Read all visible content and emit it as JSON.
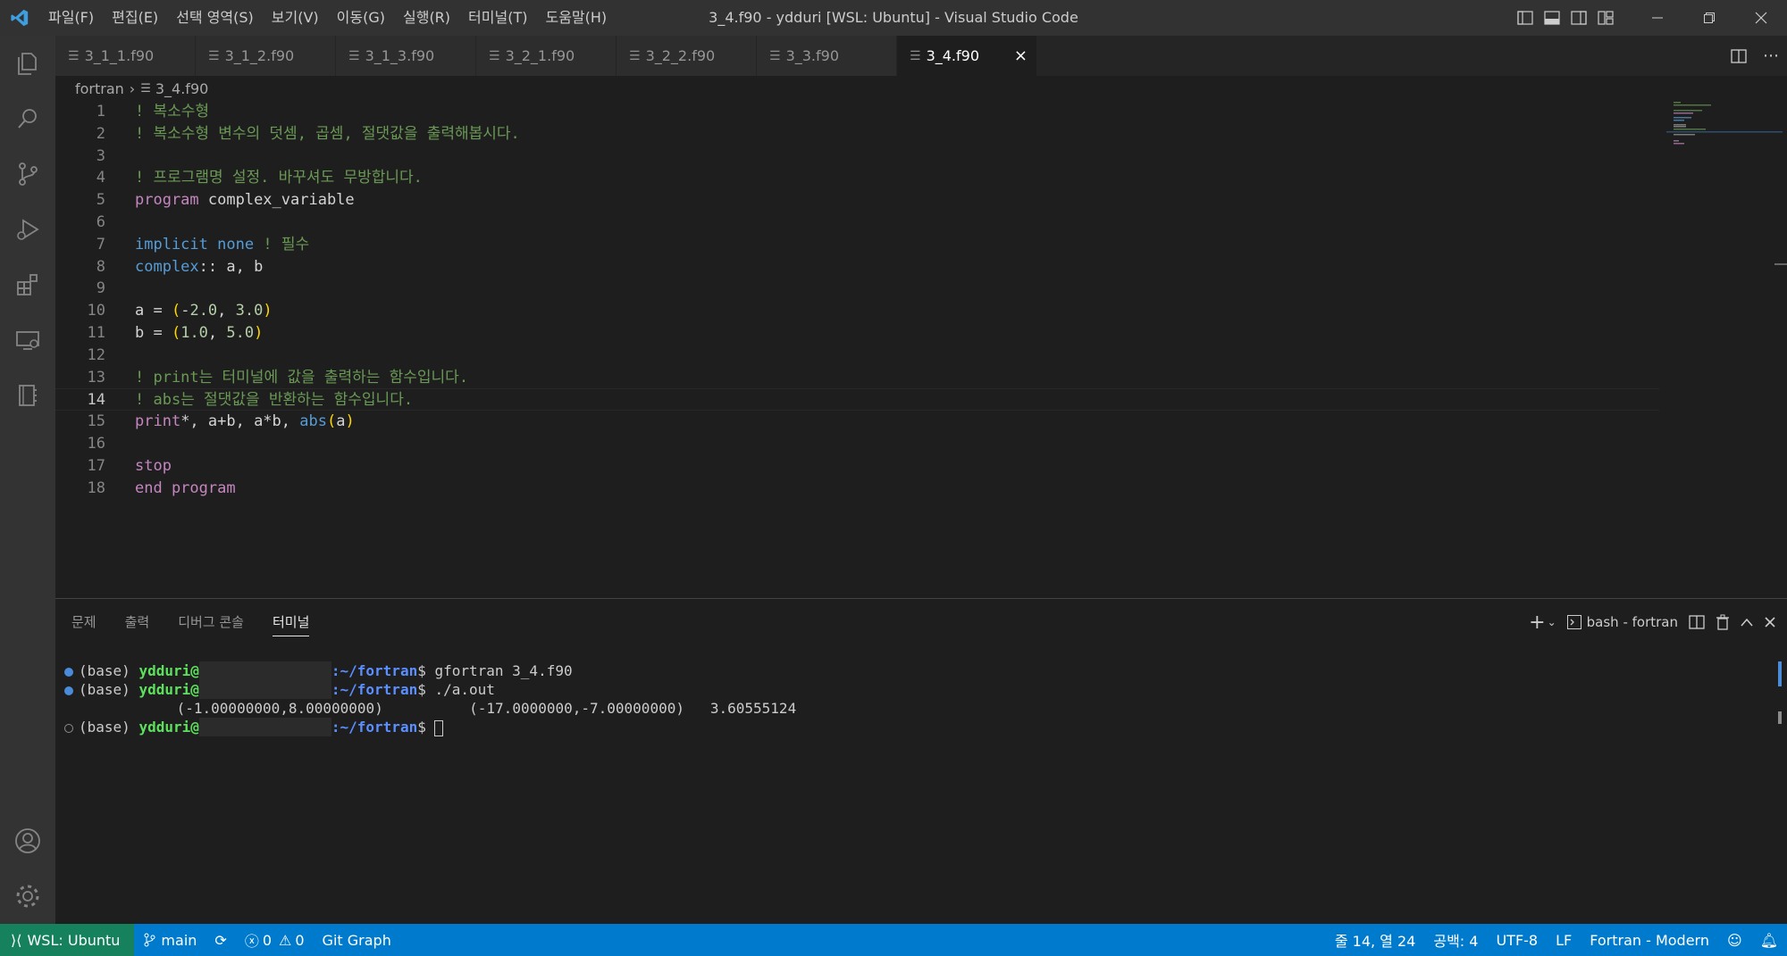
{
  "window": {
    "title": "3_4.f90 - ydduri [WSL: Ubuntu] - Visual Studio Code",
    "menu": [
      "파일(F)",
      "편집(E)",
      "선택 영역(S)",
      "보기(V)",
      "이동(G)",
      "실행(R)",
      "터미널(T)",
      "도움말(H)"
    ]
  },
  "tabs": [
    {
      "label": "3_1_1.f90",
      "active": false
    },
    {
      "label": "3_1_2.f90",
      "active": false
    },
    {
      "label": "3_1_3.f90",
      "active": false
    },
    {
      "label": "3_2_1.f90",
      "active": false
    },
    {
      "label": "3_2_2.f90",
      "active": false
    },
    {
      "label": "3_3.f90",
      "active": false
    },
    {
      "label": "3_4.f90",
      "active": true
    }
  ],
  "breadcrumb": {
    "folder": "fortran",
    "file": "3_4.f90"
  },
  "editor": {
    "current_line": 14,
    "lines": [
      {
        "n": "1",
        "tokens": [
          [
            "c-comment",
            "! 복소수형"
          ]
        ]
      },
      {
        "n": "2",
        "tokens": [
          [
            "c-comment",
            "! 복소수형 변수의 덧셈, 곱셈, 절댓값을 출력해봅시다."
          ]
        ]
      },
      {
        "n": "3",
        "tokens": []
      },
      {
        "n": "4",
        "tokens": [
          [
            "c-comment",
            "! 프로그램명 설정. 바꾸셔도 무방합니다."
          ]
        ]
      },
      {
        "n": "5",
        "tokens": [
          [
            "c-kw",
            "program"
          ],
          [
            "c-plain",
            " complex_variable"
          ]
        ]
      },
      {
        "n": "6",
        "tokens": []
      },
      {
        "n": "7",
        "tokens": [
          [
            "c-type",
            "implicit"
          ],
          [
            "c-plain",
            " "
          ],
          [
            "c-type",
            "none"
          ],
          [
            "c-plain",
            " "
          ],
          [
            "c-comment",
            "! 필수"
          ]
        ]
      },
      {
        "n": "8",
        "tokens": [
          [
            "c-type",
            "complex"
          ],
          [
            "c-plain",
            ":: a, b"
          ]
        ]
      },
      {
        "n": "9",
        "tokens": []
      },
      {
        "n": "10",
        "tokens": [
          [
            "c-plain",
            "a = "
          ],
          [
            "c-paren",
            "("
          ],
          [
            "c-plain",
            "-"
          ],
          [
            "c-num",
            "2.0"
          ],
          [
            "c-plain",
            ", "
          ],
          [
            "c-num",
            "3.0"
          ],
          [
            "c-paren",
            ")"
          ]
        ]
      },
      {
        "n": "11",
        "tokens": [
          [
            "c-plain",
            "b = "
          ],
          [
            "c-paren",
            "("
          ],
          [
            "c-num",
            "1.0"
          ],
          [
            "c-plain",
            ", "
          ],
          [
            "c-num",
            "5.0"
          ],
          [
            "c-paren",
            ")"
          ]
        ]
      },
      {
        "n": "12",
        "tokens": []
      },
      {
        "n": "13",
        "tokens": [
          [
            "c-comment",
            "! print는 터미널에 값을 출력하는 함수입니다."
          ]
        ]
      },
      {
        "n": "14",
        "tokens": [
          [
            "c-comment",
            "! abs는 절댓값을 반환하는 함수입니다."
          ]
        ]
      },
      {
        "n": "15",
        "tokens": [
          [
            "c-kw",
            "print"
          ],
          [
            "c-plain",
            "*, a+b, a*b, "
          ],
          [
            "c-type",
            "abs"
          ],
          [
            "c-paren",
            "("
          ],
          [
            "c-plain",
            "a"
          ],
          [
            "c-paren",
            ")"
          ]
        ]
      },
      {
        "n": "16",
        "tokens": []
      },
      {
        "n": "17",
        "tokens": [
          [
            "c-kw",
            "stop"
          ]
        ]
      },
      {
        "n": "18",
        "tokens": [
          [
            "c-kw",
            "end program"
          ]
        ]
      }
    ]
  },
  "panel": {
    "tabs": [
      {
        "label": "문제",
        "active": false
      },
      {
        "label": "출력",
        "active": false
      },
      {
        "label": "디버그 콘솔",
        "active": false
      },
      {
        "label": "터미널",
        "active": true
      }
    ],
    "terminal_name": "bash - fortran"
  },
  "terminal": {
    "prompt_env": "(base) ",
    "user": "ydduri@",
    "path": ":~/fortran",
    "lines": [
      {
        "type": "prompt",
        "dot": "filled",
        "cmd": "$ gfortran 3_4.f90"
      },
      {
        "type": "prompt",
        "dot": "filled",
        "cmd": "$ ./a.out"
      },
      {
        "type": "output",
        "text": " (-1.00000000,8.00000000)          (-17.0000000,-7.00000000)   3.60555124"
      },
      {
        "type": "prompt",
        "dot": "empty",
        "cmd": "$ ",
        "cursor": true
      }
    ]
  },
  "statusbar": {
    "remote": "WSL: Ubuntu",
    "branch": "main",
    "errors": "0",
    "warnings": "0",
    "git_graph": "Git Graph",
    "position": "줄 14, 열 24",
    "spaces": "공백: 4",
    "encoding": "UTF-8",
    "eol": "LF",
    "language": "Fortran - Modern"
  },
  "colors": {
    "accent": "#007acc",
    "remote": "#16825d",
    "comment": "#6a9955",
    "keyword": "#c586c0",
    "type": "#569cd6"
  }
}
